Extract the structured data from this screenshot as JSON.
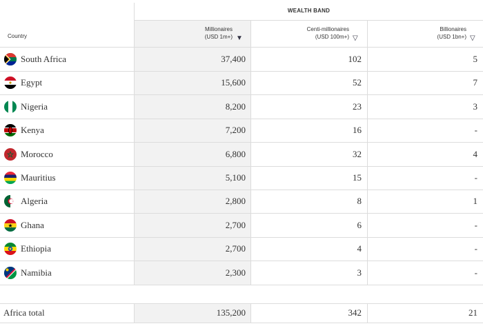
{
  "table": {
    "band_title": "WEALTH BAND",
    "country_header": "Country",
    "columns": [
      {
        "line1": "Millionaires",
        "line2": "(USD 1m+)",
        "sort_icon": "sort-desc-filled",
        "sort_glyph": "▼"
      },
      {
        "line1": "Centi-millionaires",
        "line2": "(USD 100m+)",
        "sort_icon": "sort-outline",
        "sort_glyph": "▽"
      },
      {
        "line1": "Billionaires",
        "line2": "(USD 1bn+)",
        "sort_icon": "sort-outline",
        "sort_glyph": "▽"
      }
    ],
    "rows": [
      {
        "country": "South Africa",
        "flag": "south-africa-flag",
        "millionaires": "37,400",
        "centi": "102",
        "billionaires": "5"
      },
      {
        "country": "Egypt",
        "flag": "egypt-flag",
        "millionaires": "15,600",
        "centi": "52",
        "billionaires": "7"
      },
      {
        "country": "Nigeria",
        "flag": "nigeria-flag",
        "millionaires": "8,200",
        "centi": "23",
        "billionaires": "3"
      },
      {
        "country": "Kenya",
        "flag": "kenya-flag",
        "millionaires": "7,200",
        "centi": "16",
        "billionaires": "-"
      },
      {
        "country": "Morocco",
        "flag": "morocco-flag",
        "millionaires": "6,800",
        "centi": "32",
        "billionaires": "4"
      },
      {
        "country": "Mauritius",
        "flag": "mauritius-flag",
        "millionaires": "5,100",
        "centi": "15",
        "billionaires": "-"
      },
      {
        "country": "Algeria",
        "flag": "algeria-flag",
        "millionaires": "2,800",
        "centi": "8",
        "billionaires": "1"
      },
      {
        "country": "Ghana",
        "flag": "ghana-flag",
        "millionaires": "2,700",
        "centi": "6",
        "billionaires": "-"
      },
      {
        "country": "Ethiopia",
        "flag": "ethiopia-flag",
        "millionaires": "2,700",
        "centi": "4",
        "billionaires": "-"
      },
      {
        "country": "Namibia",
        "flag": "namibia-flag",
        "millionaires": "2,300",
        "centi": "3",
        "billionaires": "-"
      }
    ],
    "total": {
      "label": "Africa total",
      "millionaires": "135,200",
      "centi": "342",
      "billionaires": "21"
    }
  },
  "colors": {
    "sorted_column_bg": "#f2f2f2",
    "grid_line": "#dcdcdc",
    "text": "#333333"
  }
}
